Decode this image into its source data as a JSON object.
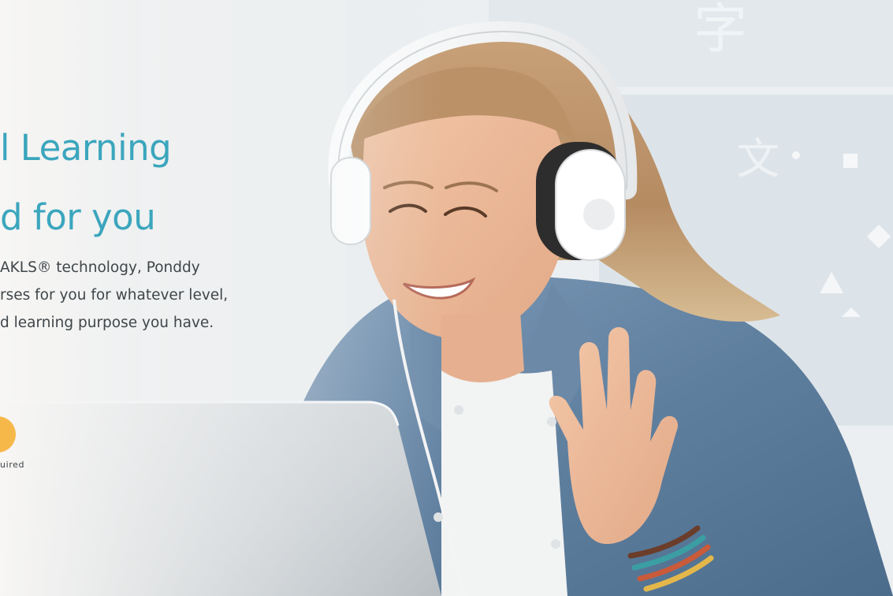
{
  "hero": {
    "headline_line1": "l Learning",
    "headline_line2": "d for you",
    "description_lines": [
      "AKLS® technology, Ponddy",
      "rses for you for whatever level,",
      "d learning purpose you have."
    ],
    "cta_note": "uired"
  },
  "image": {
    "icon": "student-with-headphones-waving-at-laptop",
    "background_glyphs": [
      "字",
      "文"
    ]
  },
  "colors": {
    "headline": "#3ba6bd",
    "body_text": "#3f4549",
    "cta": "#f7b84a"
  }
}
